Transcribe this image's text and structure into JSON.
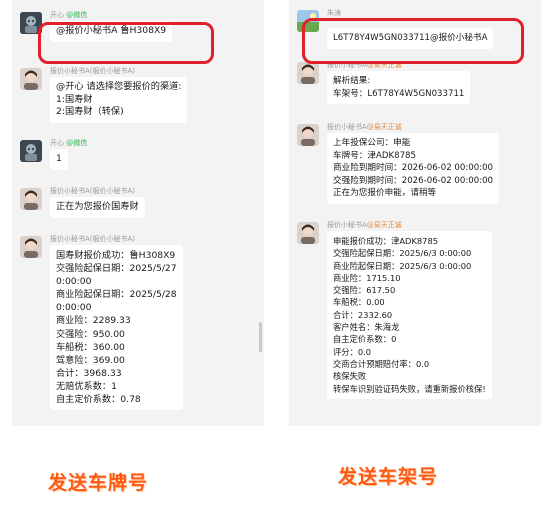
{
  "colors": {
    "highlight": "#e0202a",
    "caption": "#ff5a14",
    "sender_tag_wechat": "#2bb24c",
    "sender_tag_org": "#e8893a"
  },
  "left": {
    "messages": [
      {
        "avatar": "robot-avatar",
        "sender_name": "开心",
        "sender_tag": "@微信",
        "lines": [
          "@报价小秘书A  鲁H308X9"
        ]
      },
      {
        "avatar": "assistant-avatar",
        "sender_name": "报价小秘书A(报价小秘书A)",
        "sender_tag": "",
        "lines": [
          "@开心  请选择您要报价的渠道:",
          "1:国寿财",
          "2:国寿财（转保)"
        ]
      },
      {
        "avatar": "robot-avatar",
        "sender_name": "开心",
        "sender_tag": "@微信",
        "lines": [
          "1"
        ]
      },
      {
        "avatar": "assistant-avatar",
        "sender_name": "报价小秘书A(报价小秘书A)",
        "sender_tag": "",
        "lines": [
          "正在为您报价国寿财"
        ]
      },
      {
        "avatar": "assistant-avatar",
        "sender_name": "报价小秘书A(报价小秘书A)",
        "sender_tag": "",
        "lines": [
          "国寿财报价成功：鲁H308X9",
          "交强险起保日期：2025/5/27",
          "0:00:00",
          "商业险起保日期：2025/5/28",
          "0:00:00",
          "商业险：2289.33",
          "交强险：950.00",
          "车船税：360.00",
          "驾意险：369.00",
          "合计：3968.33",
          "无赔优系数：1",
          "自主定价系数：0.78"
        ]
      }
    ]
  },
  "right": {
    "messages": [
      {
        "avatar": "landscape-avatar",
        "sender_name": "朱涛",
        "sender_tag": "",
        "lines": [
          "L6T78Y4W5GN033711@报价小秘书A"
        ]
      },
      {
        "avatar": "assistant-avatar",
        "sender_name": "报价小秘书A",
        "sender_tag": "@易天正诚",
        "lines": [
          "解析结果:",
          "车架号：L6T78Y4W5GN033711"
        ]
      },
      {
        "avatar": "assistant-avatar",
        "sender_name": "报价小秘书A",
        "sender_tag": "@易天正诚",
        "lines": [
          "上年投保公司：申能",
          "车牌号：津ADK8785",
          "商业险到期时间：2026-06-02 00:00:00",
          "交强险到期时间：2026-06-02 00:00:00",
          "正在为您报价申能，请稍等"
        ]
      },
      {
        "avatar": "assistant-avatar",
        "sender_name": "报价小秘书A",
        "sender_tag": "@易天正诚",
        "lines": [
          "申能报价成功：津ADK8785",
          "交强险起保日期：2025/6/3 0:00:00",
          "商业险起保日期：2025/6/3 0:00:00",
          "商业险：1715.10",
          "交强险：617.50",
          "车船税：0.00",
          "合计：2332.60",
          "客户姓名：朱海龙",
          "自主定价系数：0",
          "评分：0.0",
          "交商合计预期赔付率：0.0",
          "核保失败",
          "转保车识别验证码失败，请重新报价核保!"
        ]
      }
    ]
  },
  "captions": {
    "left": "发送车牌号",
    "right": "发送车架号"
  }
}
